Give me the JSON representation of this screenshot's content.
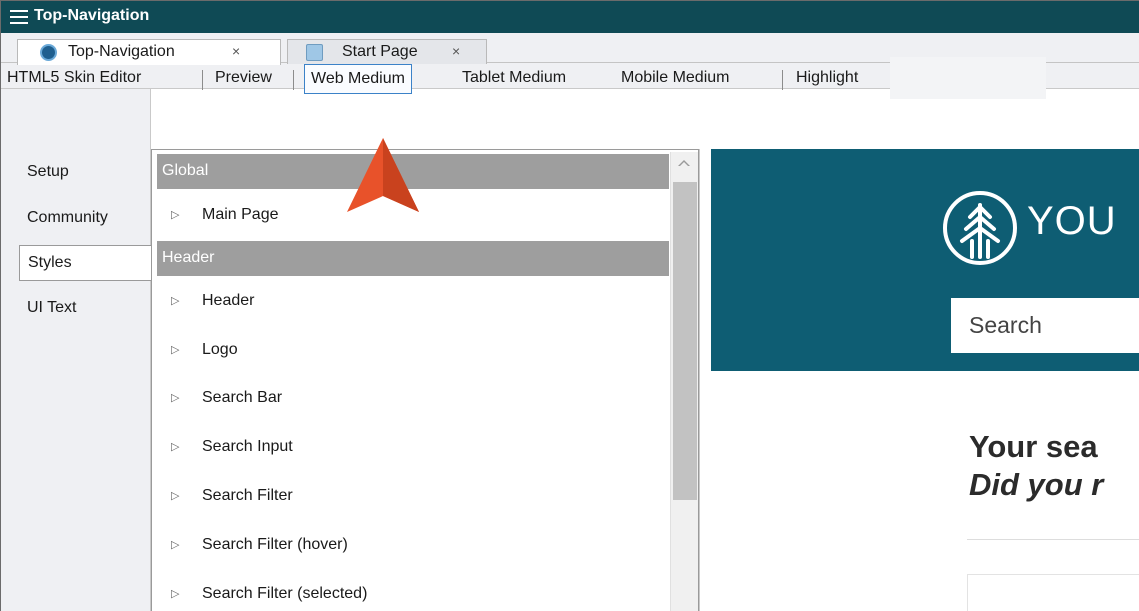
{
  "window": {
    "title": "Top-Navigation"
  },
  "tabs": [
    {
      "label": "Top-Navigation",
      "close": "×",
      "icon": "globe-icon",
      "active": true
    },
    {
      "label": "Start Page",
      "close": "×",
      "icon": "page-icon",
      "active": false
    }
  ],
  "toolbar": {
    "items": [
      "HTML5 Skin Editor",
      "Preview",
      "Web Medium",
      "Tablet Medium",
      "Mobile Medium",
      "Highlight"
    ],
    "selected": "Web Medium"
  },
  "left_tabs": {
    "items": [
      "Setup",
      "Community",
      "Styles",
      "UI Text"
    ],
    "active": "Styles"
  },
  "styles_list": {
    "groups": [
      {
        "header": "Global",
        "items": [
          "Main Page"
        ]
      },
      {
        "header": "Header",
        "items": [
          "Header",
          "Logo",
          "Search Bar",
          "Search Input",
          "Search Filter",
          "Search Filter (hover)",
          "Search Filter (selected)"
        ]
      }
    ]
  },
  "preview": {
    "logo_text": "YOU",
    "search_placeholder": "Search",
    "heading": "Your sea",
    "subheading": "Did you r"
  },
  "colors": {
    "titlebar": "#0f4a55",
    "preview_header": "#0e5d73",
    "group_header": "#9e9e9e",
    "selection_border": "#3b82c8",
    "callout": "#e8522a"
  }
}
